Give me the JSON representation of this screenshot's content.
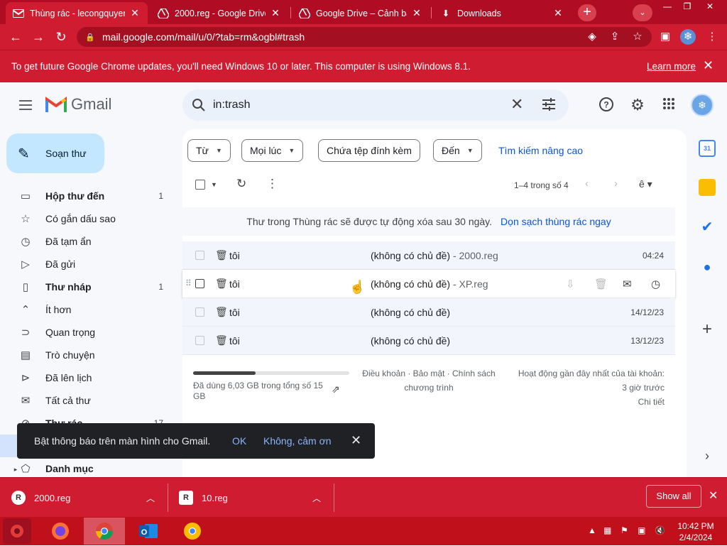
{
  "browser": {
    "tabs": [
      {
        "title": "Thùng rác - lecongquyen",
        "icon": "gmail-icon",
        "active": true
      },
      {
        "title": "2000.reg - Google Drive",
        "icon": "google-drive-icon",
        "active": false
      },
      {
        "title": "Google Drive – Cảnh báo",
        "icon": "google-drive-icon",
        "active": false
      },
      {
        "title": "Downloads",
        "icon": "download-icon",
        "active": false
      }
    ],
    "url": "mail.google.com/mail/u/0/?tab=rm&ogbl#trash",
    "infobar": {
      "message": "To get future Google Chrome updates, you'll need Windows 10 or later. This computer is using Windows 8.1.",
      "link": "Learn more"
    }
  },
  "gmail": {
    "brand": "Gmail",
    "search_query": "in:trash",
    "compose_label": "Soạn thư",
    "nav": [
      {
        "label": "Hộp thư đến",
        "count": "1",
        "bold": true,
        "icon": "inbox-icon"
      },
      {
        "label": "Có gắn dấu sao",
        "count": "",
        "bold": false,
        "icon": "star-icon"
      },
      {
        "label": "Đã tạm ẩn",
        "count": "",
        "bold": false,
        "icon": "clock-icon"
      },
      {
        "label": "Đã gửi",
        "count": "",
        "bold": false,
        "icon": "send-icon"
      },
      {
        "label": "Thư nháp",
        "count": "1",
        "bold": true,
        "icon": "draft-icon"
      },
      {
        "label": "Ít hơn",
        "count": "",
        "bold": false,
        "icon": "chevron-up-icon"
      },
      {
        "label": "Quan trọng",
        "count": "",
        "bold": false,
        "icon": "important-icon"
      },
      {
        "label": "Trò chuyện",
        "count": "",
        "bold": false,
        "icon": "chat-icon"
      },
      {
        "label": "Đã lên lịch",
        "count": "",
        "bold": false,
        "icon": "scheduled-icon"
      },
      {
        "label": "Tất cả thư",
        "count": "",
        "bold": false,
        "icon": "all-mail-icon"
      },
      {
        "label": "Thư rác",
        "count": "17",
        "bold": true,
        "icon": "spam-icon"
      }
    ],
    "categories_label": "Danh mục",
    "filters": [
      "Từ",
      "Mọi lúc",
      "Chứa tệp đính kèm",
      "Đến"
    ],
    "advanced_search": "Tìm kiếm nâng cao",
    "pagination": "1–4 trong số 4",
    "trash_notice": "Thư trong Thùng rác sẽ được tự động xóa sau 30 ngày.",
    "empty_trash": "Dọn sạch thùng rác ngay",
    "emails": [
      {
        "from": "tôi",
        "subject": "(không có chủ đề)",
        "snippet": " - 2000.reg",
        "date": "04:24"
      },
      {
        "from": "tôi",
        "subject": "(không có chủ đề)",
        "snippet": " - XP.reg",
        "date": ""
      },
      {
        "from": "tôi",
        "subject": "(không có chủ đề)",
        "snippet": "",
        "date": "14/12/23"
      },
      {
        "from": "tôi",
        "subject": "(không có chủ đề)",
        "snippet": "",
        "date": "13/12/23"
      }
    ],
    "storage": {
      "text": "Đã dùng 6,03 GB trong tổng số 15 GB",
      "fraction": 0.4
    },
    "footer_links": "Điều khoản · Bảo mật · Chính sách chương trình",
    "activity": {
      "line1": "Hoạt động gần đây nhất của tài khoản:",
      "line2": "3 giờ trước",
      "line3": "Chi tiết"
    },
    "snackbar": {
      "message": "Bật thông báo trên màn hình cho Gmail.",
      "ok": "OK",
      "dismiss": "Không, cảm ơn"
    }
  },
  "downloads": {
    "items": [
      {
        "name": "2000.reg"
      },
      {
        "name": "10.reg"
      }
    ],
    "show_all": "Show all"
  },
  "taskbar": {
    "time": "10:42 PM",
    "date": "2/4/2024"
  }
}
